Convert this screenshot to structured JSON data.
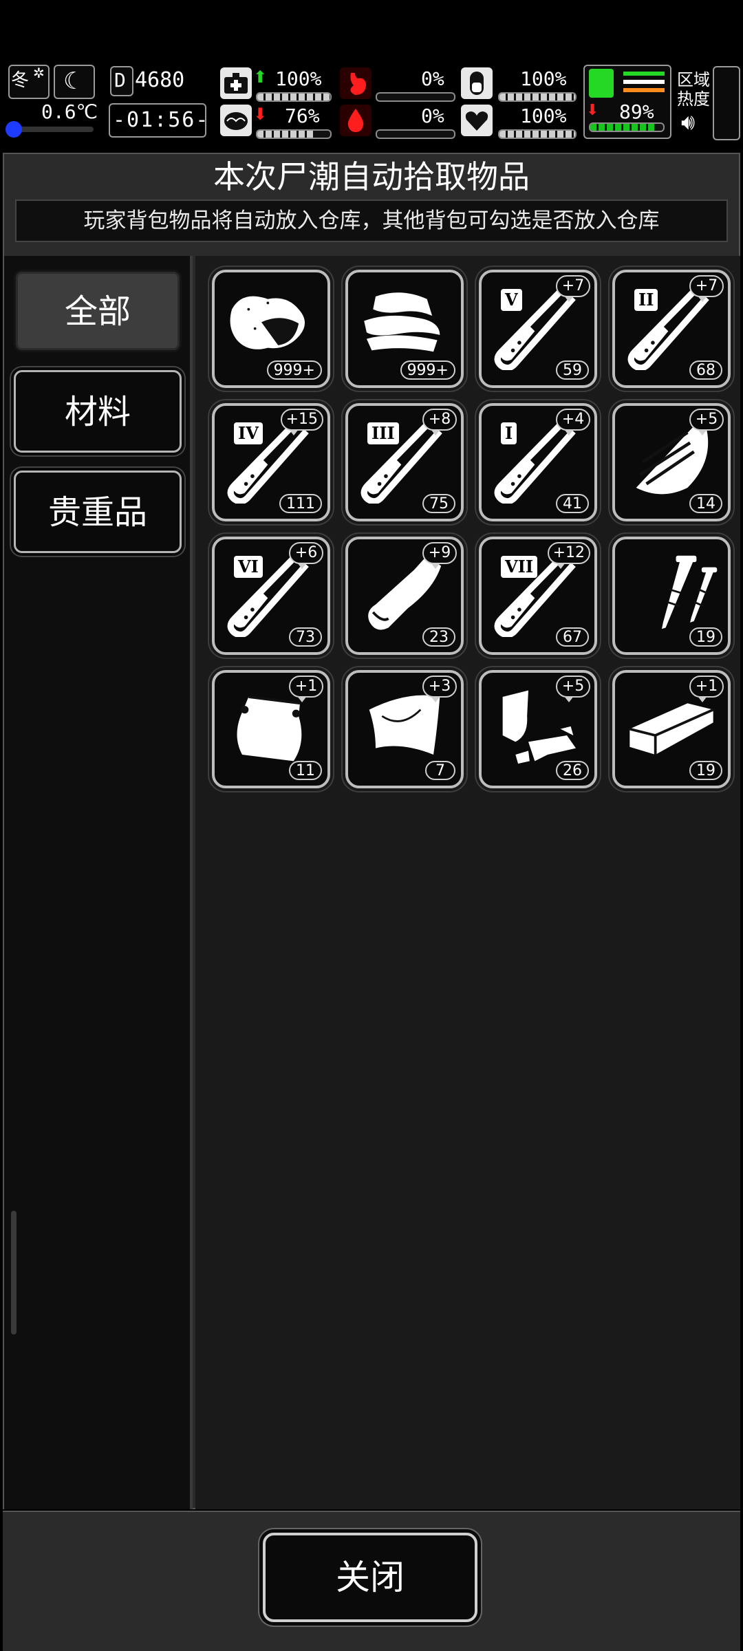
{
  "status": {
    "season": "冬",
    "temperature": "0.6℃",
    "day_label": "D",
    "day_value": "4680",
    "clock": "-01:56-",
    "health_pct": "100%",
    "hunger_pct": "0%",
    "pill_pct": "100%",
    "sanity_pct": "76%",
    "blood_pct": "0%",
    "heart_pct": "100%",
    "stamina_pct": "89%",
    "zone_heat_label": "区域热度",
    "levels": {
      "health": 1.0,
      "sanity": 0.76,
      "hunger": 0.0,
      "blood": 0.0,
      "pill": 1.0,
      "heart": 1.0,
      "stamina": 0.89
    }
  },
  "header": {
    "title": "本次尸潮自动拾取物品",
    "subtitle": "玩家背包物品将自动放入仓库，其他背包可勾选是否放入仓库"
  },
  "sidebar": {
    "tabs": [
      {
        "label": "全部",
        "active": true
      },
      {
        "label": "材料",
        "active": false
      },
      {
        "label": "贵重品",
        "active": false
      }
    ]
  },
  "items": [
    {
      "icon": "cloth-bundle-icon",
      "count": "999+",
      "plus": ""
    },
    {
      "icon": "folded-cloth-icon",
      "count": "999+",
      "plus": ""
    },
    {
      "icon": "test-tube-icon",
      "roman": "V",
      "count": "59",
      "plus": "+7"
    },
    {
      "icon": "test-tube-icon",
      "roman": "II",
      "count": "68",
      "plus": "+7"
    },
    {
      "icon": "test-tube-icon",
      "roman": "IV",
      "count": "111",
      "plus": "+15"
    },
    {
      "icon": "test-tube-icon",
      "roman": "III",
      "count": "75",
      "plus": "+8"
    },
    {
      "icon": "test-tube-icon",
      "roman": "I",
      "count": "41",
      "plus": "+4"
    },
    {
      "icon": "wood-plank-icon",
      "count": "14",
      "plus": "+5"
    },
    {
      "icon": "test-tube-icon",
      "roman": "VI",
      "count": "73",
      "plus": "+6"
    },
    {
      "icon": "leather-roll-icon",
      "count": "23",
      "plus": "+9"
    },
    {
      "icon": "test-tube-icon",
      "roman": "VII",
      "count": "67",
      "plus": "+12"
    },
    {
      "icon": "nails-icon",
      "count": "19",
      "plus": ""
    },
    {
      "icon": "pouch-icon",
      "count": "11",
      "plus": "+1"
    },
    {
      "icon": "plastic-sheet-icon",
      "count": "7",
      "plus": "+3"
    },
    {
      "icon": "scrap-parts-icon",
      "count": "26",
      "plus": "+5"
    },
    {
      "icon": "wooden-board-icon",
      "count": "19",
      "plus": "+1"
    }
  ],
  "footer": {
    "close_label": "关闭"
  }
}
